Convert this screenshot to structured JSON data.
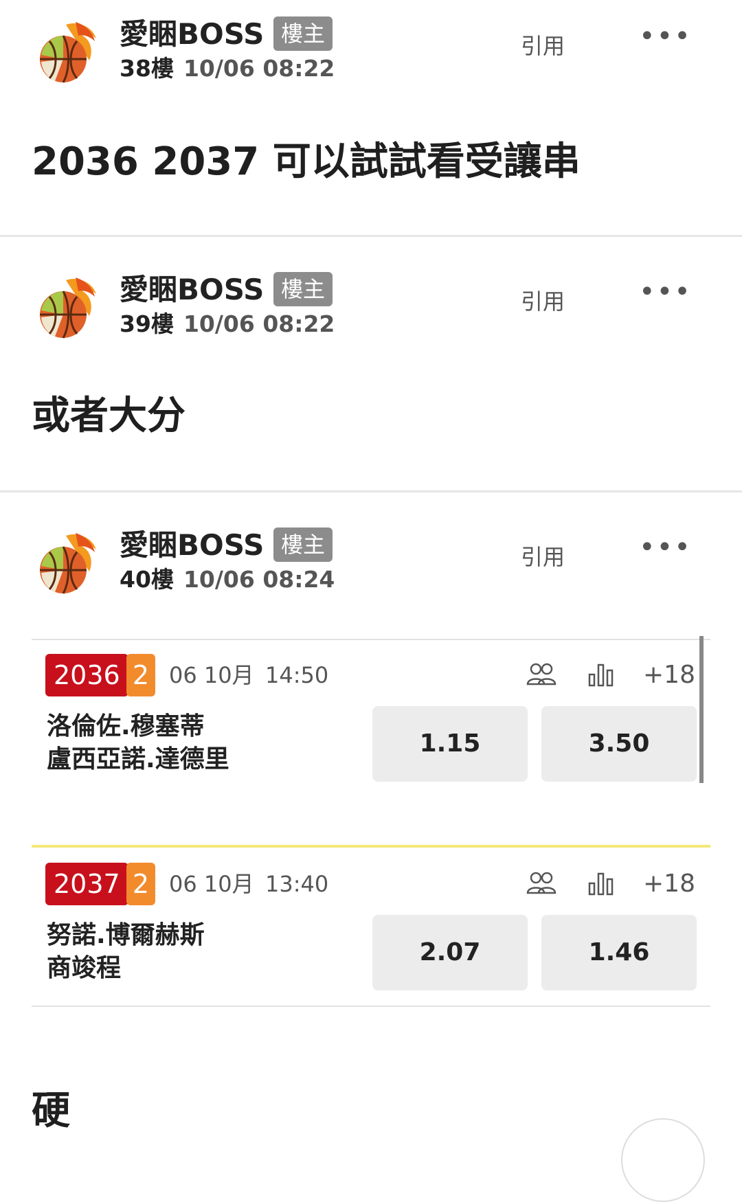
{
  "posts": [
    {
      "username": "愛睏BOSS",
      "op_badge": "樓主",
      "floor": "38樓",
      "time": "10/06 08:22",
      "quote": "引用",
      "more": "•••",
      "content": "2036 2037 可以試試看受讓串"
    },
    {
      "username": "愛睏BOSS",
      "op_badge": "樓主",
      "floor": "39樓",
      "time": "10/06 08:22",
      "quote": "引用",
      "more": "•••",
      "content": "或者大分"
    },
    {
      "username": "愛睏BOSS",
      "op_badge": "樓主",
      "floor": "40樓",
      "time": "10/06 08:24",
      "quote": "引用",
      "more": "•••"
    }
  ],
  "matches": [
    {
      "code": "2036",
      "num": "2",
      "date": "06 10月",
      "time": "14:50",
      "plus": "+18",
      "team1": "洛倫佐.穆塞蒂",
      "team2": "盧西亞諾.達德里",
      "odd1": "1.15",
      "odd2": "3.50"
    },
    {
      "code": "2037",
      "num": "2",
      "date": "06 10月",
      "time": "13:40",
      "plus": "+18",
      "team1": "努諾.博爾赫斯",
      "team2": "商竣程",
      "odd1": "2.07",
      "odd2": "1.46"
    }
  ],
  "last_post_content": "硬",
  "colors": {
    "code_badge": "#c8101d",
    "num_badge": "#f28b2c",
    "op_badge": "#8c8c8c"
  },
  "icons": {
    "players": "players-icon",
    "stats": "stats-icon",
    "more": "more-icon"
  }
}
